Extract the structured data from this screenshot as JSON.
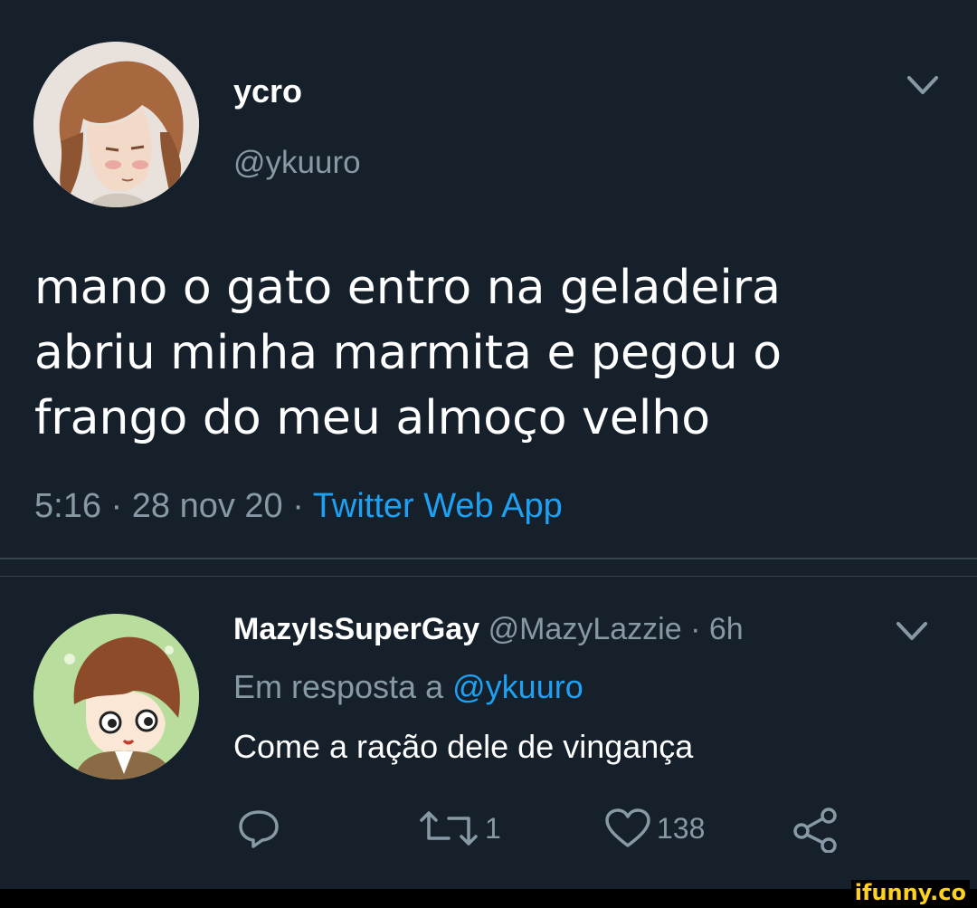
{
  "tweet": {
    "author": {
      "display_name": "ycro",
      "handle": "@ykuuro"
    },
    "text_lines": [
      "mano o gato entro na geladeira",
      "abriu minha marmita e pegou o",
      "frango do meu almoço velho"
    ],
    "time": "5:16",
    "date": "28 nov 20",
    "separator": "·",
    "source": "Twitter Web App"
  },
  "reply": {
    "display_name": "MazyIsSuperGay",
    "handle": "@MazyLazzie",
    "age": "6h",
    "separator": "·",
    "in_reply_to_label": "Em resposta a",
    "in_reply_to_handle": "@ykuuro",
    "text": "Come a ração dele de vingança",
    "actions": {
      "reply_icon": "comment-icon",
      "retweet_icon": "retweet-icon",
      "retweet_count": "1",
      "like_icon": "heart-icon",
      "like_count": "138",
      "share_icon": "share-icon"
    }
  },
  "watermark": "ifunny.co",
  "colors": {
    "background": "#15202b",
    "text_primary": "#ffffff",
    "text_secondary": "#8899a6",
    "link": "#1da1f2",
    "divider": "#38444d"
  }
}
